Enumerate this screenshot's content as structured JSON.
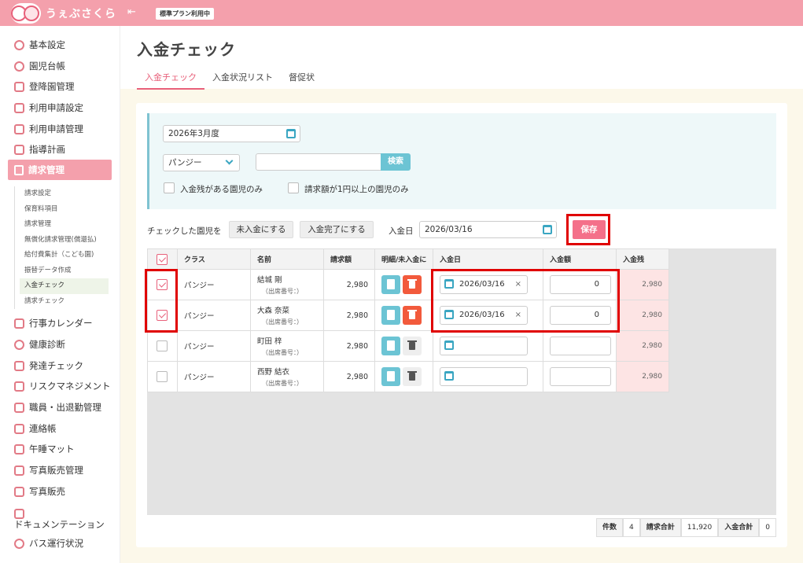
{
  "app": {
    "name": "うぇぶさくら",
    "plan_badge": "標準プラン利用中"
  },
  "sidebar": {
    "items": [
      {
        "label": "基本設定",
        "icon": "gear-icon"
      },
      {
        "label": "園児台帳",
        "icon": "child-icon"
      },
      {
        "label": "登降園管理",
        "icon": "building-icon"
      },
      {
        "label": "利用申請設定",
        "icon": "calendar-icon"
      },
      {
        "label": "利用申請管理",
        "icon": "calendar-icon"
      },
      {
        "label": "指導計画",
        "icon": "list-icon"
      },
      {
        "label": "請求管理",
        "icon": "invoice-icon"
      }
    ],
    "sub_items": [
      "請求設定",
      "保育料項目",
      "請求管理",
      "無償化請求管理(償還払)",
      "給付費集計（こども園)",
      "振替データ作成",
      "入金チェック",
      "請求チェック"
    ],
    "items2": [
      {
        "label": "行事カレンダー"
      },
      {
        "label": "健康診断"
      },
      {
        "label": "発達チェック"
      },
      {
        "label": "リスクマネジメント"
      },
      {
        "label": "職員・出退勤管理"
      },
      {
        "label": "連絡帳"
      },
      {
        "label": "午睡マット"
      },
      {
        "label": "写真販売管理"
      },
      {
        "label": "写真販売"
      }
    ],
    "doc_label": "ドキュメンテーション",
    "bus_label": "バス運行状況"
  },
  "page": {
    "title": "入金チェック",
    "tabs": [
      "入金チェック",
      "入金状況リスト",
      "督促状"
    ]
  },
  "filter": {
    "month": "2026年3月度",
    "class_select": "パンジー",
    "search_value": "",
    "search_button": "検索",
    "cb1": "入金残がある園児のみ",
    "cb2": "請求額が1円以上の園児のみ"
  },
  "actions": {
    "label": "チェックした園児を",
    "unpaid_button": "未入金にする",
    "paid_button": "入金完了にする",
    "date_label": "入金日",
    "date_value": "2026/03/16",
    "save_button": "保存"
  },
  "table": {
    "headers": [
      "クラス",
      "名前",
      "請求額",
      "明細/未入金に",
      "入金日",
      "入金額",
      "入金残"
    ],
    "rows": [
      {
        "checked": true,
        "class": "パンジー",
        "name": "結城 剛",
        "sub": "（出席番号：）",
        "amount": "2,980",
        "active": true,
        "date": "2026/03/16",
        "paid": "0",
        "balance": "2,980"
      },
      {
        "checked": true,
        "class": "パンジー",
        "name": "大森 奈菜",
        "sub": "（出席番号：）",
        "amount": "2,980",
        "active": true,
        "date": "2026/03/16",
        "paid": "0",
        "balance": "2,980"
      },
      {
        "checked": false,
        "class": "パンジー",
        "name": "町田 梓",
        "sub": "（出席番号：）",
        "amount": "2,980",
        "active": false,
        "date": "",
        "paid": "",
        "balance": "2,980"
      },
      {
        "checked": false,
        "class": "パンジー",
        "name": "西野 結衣",
        "sub": "（出席番号：）",
        "amount": "2,980",
        "active": false,
        "date": "",
        "paid": "",
        "balance": "2,980"
      }
    ]
  },
  "totals": {
    "count_label": "件数",
    "count": "4",
    "billed_label": "請求合計",
    "billed": "11,920",
    "paid_label": "入金合計",
    "paid": "0"
  },
  "colors": {
    "brand": "#f4a0ac",
    "accent": "#e8607a",
    "teal": "#6cc4d4",
    "highlight": "#e00000"
  }
}
